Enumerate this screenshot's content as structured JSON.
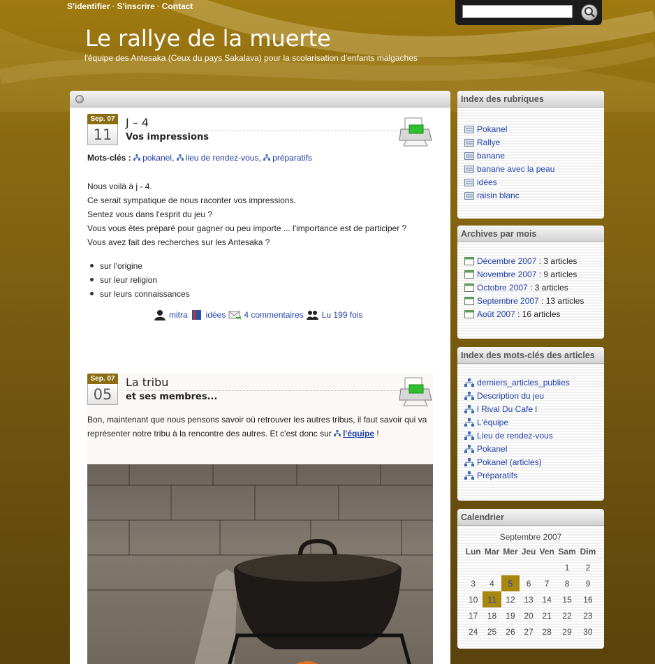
{
  "topnav": {
    "login": "S'identifier",
    "register": "S'inscrire",
    "contact": "Contact"
  },
  "search": {
    "placeholder": ""
  },
  "site": {
    "title": "Le rallye de la muerte",
    "tagline": "l'équipe des Antesaka (Ceux du pays Sakalava) pour la scolarisation d'enfants malgaches"
  },
  "post1": {
    "month": "Sep. 07",
    "day": "11",
    "title": "J – 4",
    "subtitle": "Vos impressions",
    "tags_label": "Mots-clés :",
    "tags": [
      "pokanel",
      "lieu de rendez-vous",
      "préparatifs"
    ],
    "paragraphs": [
      "Nous voilà à j - 4.",
      "Ce serait sympatique de nous raconter vos impressions.",
      "Sentez vous dans l'esprit du jeu ?",
      "Vous vous êtes préparé pour gagner ou peu importe ... l'importance est de participer ?",
      "Vous avez fait des recherches sur les Antesaka ?"
    ],
    "bullets": [
      "sur l'origine",
      "sur leur religion",
      "sur leurs connaissances"
    ],
    "author": "mitra",
    "category": "idées",
    "comments": "4 commentaires",
    "views": "Lu 199 fois"
  },
  "post2": {
    "month": "Sep. 07",
    "day": "05",
    "title": "La tribu",
    "subtitle": "et ses membres...",
    "text_a": "Bon, maintenant que nous pensons savoir où retrouver les autres tribus, il faut savoir qui va représenter notre tribu à la rencontre des autres. Et c'est donc sur",
    "link": "l'équipe",
    "text_b": "!"
  },
  "sidebar": {
    "rubriques": {
      "title": "Index des rubriques",
      "items": [
        "Pokanel",
        "Rallye",
        "banane",
        "banane avec la peau",
        "idées",
        "raisin blanc"
      ]
    },
    "archives": {
      "title": "Archives par mois",
      "items": [
        {
          "month": "Décembre 2007",
          "count": " : 3 articles"
        },
        {
          "month": "Novembre 2007",
          "count": " : 9 articles"
        },
        {
          "month": "Octobre 2007",
          "count": " : 3 articles"
        },
        {
          "month": "Septembre 2007",
          "count": " : 13 articles"
        },
        {
          "month": "Août 2007",
          "count": " : 16 articles"
        }
      ]
    },
    "motscles": {
      "title": "Index des mots-clés des articles",
      "items": [
        "derniers_articles_publies",
        "Description du jeu",
        "l Rival Du Cafe l",
        "L'équipe",
        "Lieu de rendez-vous",
        "Pokanel",
        "Pokanel (articles)",
        "Préparatifs"
      ]
    },
    "calendar": {
      "title": "Calendrier",
      "caption": "Septembre 2007",
      "days": [
        "Lun",
        "Mar",
        "Mer",
        "Jeu",
        "Ven",
        "Sam",
        "Dim"
      ],
      "weeks": [
        [
          "",
          "",
          "",
          "",
          "",
          "1",
          "2"
        ],
        [
          "3",
          "4",
          "5",
          "6",
          "7",
          "8",
          "9"
        ],
        [
          "10",
          "11",
          "12",
          "13",
          "14",
          "15",
          "16"
        ],
        [
          "17",
          "18",
          "19",
          "20",
          "21",
          "22",
          "23"
        ],
        [
          "24",
          "25",
          "26",
          "27",
          "28",
          "29",
          "30"
        ]
      ],
      "linked_days": [
        "5",
        "11"
      ]
    }
  },
  "colors": {
    "gold": "#a8870e",
    "link": "#1f3fa8"
  }
}
